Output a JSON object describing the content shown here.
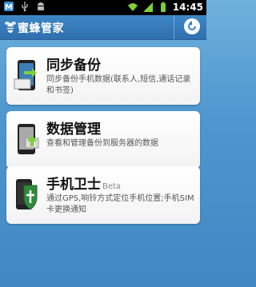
{
  "status_bar": {
    "time": "14:45",
    "icons": [
      "app-notification-icon",
      "usb-icon",
      "android-debug-icon",
      "wifi-icon",
      "signal-icon",
      "battery-icon"
    ]
  },
  "header": {
    "title": "蜜蜂管家",
    "back_icon": "refresh-back-icon"
  },
  "cards": [
    {
      "title": "同步备份",
      "description": "同步备份手机数据(联系人,短信,通话记录和书签)",
      "icon": "phone-sync-icon"
    },
    {
      "title": "数据管理",
      "description": "查看和管理备份到服务器的数据",
      "icon": "phone-manage-icon"
    },
    {
      "title": "手机卫士",
      "badge": "Beta",
      "description": "通过GPS,响铃方式定位手机位置;手机SIM卡更换通知",
      "icon": "phone-shield-icon"
    }
  ],
  "colors": {
    "background": "#4f97cf",
    "titlebar": "#3a7fbf",
    "card": "#ffffff",
    "shield": "#2e8b3a"
  }
}
